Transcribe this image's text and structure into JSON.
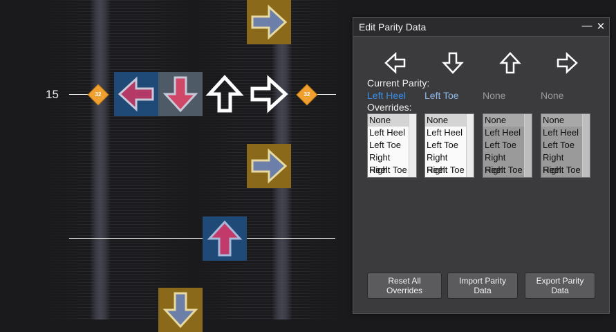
{
  "editor": {
    "measure_number": "15",
    "snap_label_left": "32",
    "snap_label_right": "32"
  },
  "panel": {
    "title": "Edit Parity Data",
    "minimize_glyph": "—",
    "close_glyph": "✕",
    "current_parity_label": "Current Parity:",
    "overrides_label": "Overrides:",
    "columns": [
      {
        "arrow": "left-arrow-icon",
        "parity": "Left Heel",
        "parity_color": "#3a8ee6",
        "enabled": true
      },
      {
        "arrow": "down-arrow-icon",
        "parity": "Left Toe",
        "parity_color": "#8ab8e8",
        "enabled": true
      },
      {
        "arrow": "up-arrow-icon",
        "parity": "None",
        "parity_color": "#9a9a9a",
        "enabled": false
      },
      {
        "arrow": "right-arrow-icon",
        "parity": "None",
        "parity_color": "#9a9a9a",
        "enabled": false
      }
    ],
    "override_options": [
      "None",
      "Left Heel",
      "Left Toe",
      "Right Heel",
      "Right Toe"
    ],
    "selected_option": "None",
    "buttons": {
      "reset": [
        "Reset All",
        "Overrides"
      ],
      "import": [
        "Import Parity",
        "Data"
      ],
      "export": [
        "Export Parity",
        "Data"
      ]
    }
  },
  "colors": {
    "note_gold": "#8a6a1a",
    "note_blue": "#1f4a78",
    "note_pink": "#c23a6a",
    "snap_orange": "#f0a030"
  }
}
